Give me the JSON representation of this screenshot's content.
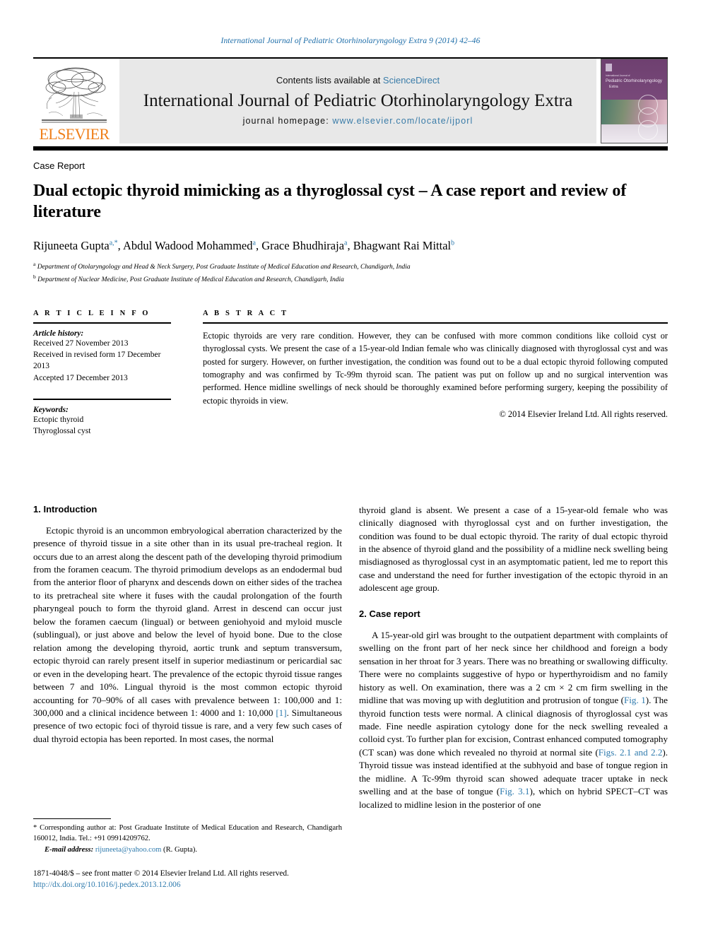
{
  "running_head": "International Journal of Pediatric Otorhinolaryngology Extra 9 (2014) 42–46",
  "masthead": {
    "contents_prefix": "Contents lists available at ",
    "sciencedirect": "ScienceDirect",
    "journal_title": "International Journal of Pediatric Otorhinolaryngology Extra",
    "homepage_label": "journal homepage: ",
    "homepage_url": "www.elsevier.com/locate/ijporl",
    "publisher": "ELSEVIER",
    "cover_line1": "International Journal of",
    "cover_line2": "Pediatric Otorhinolaryngology",
    "cover_line3": "Extra"
  },
  "article": {
    "type": "Case Report",
    "title": "Dual ectopic thyroid mimicking as a thyroglossal cyst – A case report and review of literature",
    "authors_html": "Rijuneeta Gupta<sup>a,*</sup>, Abdul Wadood Mohammed<sup>a</sup>, Grace Bhudhiraja<sup>a</sup>, Bhagwant Rai Mittal<sup>b</sup>",
    "affiliation_a": "Department of Otolaryngology and Head & Neck Surgery, Post Graduate Institute of Medical Education and Research, Chandigarh, India",
    "affiliation_b": "Department of Nuclear Medicine, Post Graduate Institute of Medical Education and Research, Chandigarh, India"
  },
  "article_info": {
    "heading": "A R T I C L E   I N F O",
    "history_label": "Article history:",
    "received": "Received 27 November 2013",
    "revised": "Received in revised form 17 December 2013",
    "accepted": "Accepted 17 December 2013",
    "keywords_label": "Keywords:",
    "keyword_1": "Ectopic thyroid",
    "keyword_2": "Thyroglossal cyst"
  },
  "abstract": {
    "heading": "A B S T R A C T",
    "text": "Ectopic thyroids are very rare condition. However, they can be confused with more common conditions like colloid cyst or thyroglossal cysts. We present the case of a 15-year-old Indian female who was clinically diagnosed with thyroglossal cyst and was posted for surgery. However, on further investigation, the condition was found out to be a dual ectopic thyroid following computed tomography and was confirmed by Tc-99m thyroid scan. The patient was put on follow up and no surgical intervention was performed. Hence midline swellings of neck should be thoroughly examined before performing surgery, keeping the possibility of ectopic thyroids in view.",
    "copyright": "© 2014 Elsevier Ireland Ltd. All rights reserved."
  },
  "body": {
    "intro_heading": "1. Introduction",
    "intro_p1_a": "Ectopic thyroid is an uncommon embryological aberration characterized by the presence of thyroid tissue in a site other than in its usual pre-tracheal region. It occurs due to an arrest along the descent path of the developing thyroid primodium from the foramen ceacum. The thyroid primodium develops as an endodermal bud from the anterior floor of pharynx and descends down on either sides of the trachea to its pretracheal site where it fuses with the caudal prolongation of the fourth pharyngeal pouch to form the thyroid gland. Arrest in descend can occur just below the foramen caecum (lingual) or between geniohyoid and myloid muscle (sublingual), or just above and below the level of hyoid bone. Due to the close relation among the developing thyroid, aortic trunk and septum transversum, ectopic thyroid can rarely present itself in superior mediastinum or pericardial sac or even in the developing heart. The prevalence of the ectopic thyroid tissue ranges between 7 and 10%. Lingual thyroid is the most common ectopic thyroid accounting for 70–90% of all cases with prevalence between 1: 100,000 and 1: 300,000 and a clinical incidence between 1: 4000 and 1: 10,000 ",
    "intro_ref": "[1]",
    "intro_p1_b": ". Simultaneous presence of two ectopic foci of thyroid tissue is rare, and a very few such cases of dual thyroid ectopia has been reported. In most cases, the normal",
    "intro_p1_cont": "thyroid gland is absent. We present a case of a 15-year-old female who was clinically diagnosed with thyroglossal cyst and on further investigation, the condition was found to be dual ectopic thyroid. The rarity of dual ectopic thyroid in the absence of thyroid gland and the possibility of a midline neck swelling being misdiagnosed as thyroglossal cyst in an asymptomatic patient, led me to report this case and understand the need for further investigation of the ectopic thyroid in an adolescent age group.",
    "case_heading": "2. Case report",
    "case_p1_a": "A 15-year-old girl was brought to the outpatient department with complaints of swelling on the front part of her neck since her childhood and foreign a body sensation in her throat for 3 years. There was no breathing or swallowing difficulty. There were no complaints suggestive of hypo or hyperthyroidism and no family history as well. On examination, there was a 2 cm × 2 cm firm swelling in the midline that was moving up with deglutition and protrusion of tongue (",
    "case_figref1": "Fig. 1",
    "case_p1_b": "). The thyroid function tests were normal. A clinical diagnosis of thyroglossal cyst was made. Fine needle aspiration cytology done for the neck swelling revealed a colloid cyst. To further plan for excision, Contrast enhanced computed tomography (CT scan) was done which revealed no thyroid at normal site (",
    "case_figref2": "Figs. 2.1 and 2.2",
    "case_p1_c": "). Thyroid tissue was instead identified at the subhyoid and base of tongue region in the midline. A Tc-99m thyroid scan showed adequate tracer uptake in neck swelling and at the base of tongue (",
    "case_figref3": "Fig. 3.1",
    "case_p1_d": "), which on hybrid SPECT–CT was localized to midline lesion in the posterior of one"
  },
  "footnotes": {
    "corresponding_star": "*",
    "corresponding": " Corresponding author at: Post Graduate Institute of Medical Education and Research, Chandigarh 160012, India. Tel.: +91 09914209762.",
    "email_label": "E-mail address:",
    "email": "rijuneeta@yahoo.com",
    "email_suffix": " (R. Gupta).",
    "imprint": "1871-4048/$ – see front matter © 2014 Elsevier Ireland Ltd. All rights reserved.",
    "doi": "http://dx.doi.org/10.1016/j.pedex.2013.12.006"
  },
  "colors": {
    "link_blue": "#2e7aad",
    "header_blue": "#1b6ca8",
    "elsevier_orange": "#ef7f1a",
    "masthead_gray": "#e8e8e8"
  }
}
